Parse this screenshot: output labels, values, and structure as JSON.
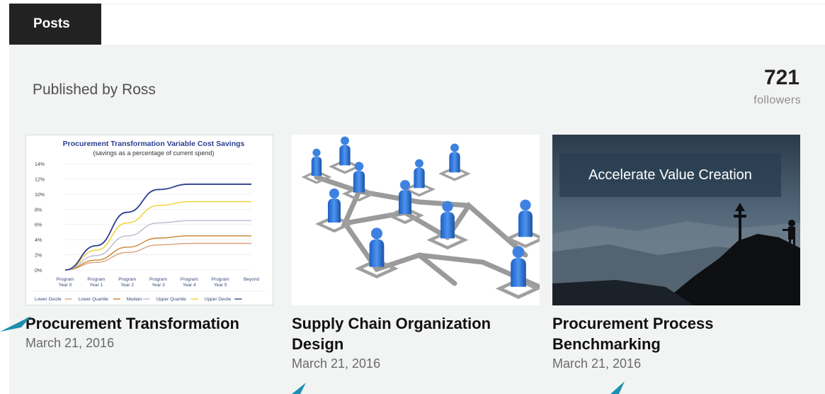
{
  "tab": {
    "label": "Posts"
  },
  "header": {
    "published_by": "Published by Ross",
    "followers_count": "721",
    "followers_label": "followers"
  },
  "posts": [
    {
      "title": "Procurement Transformation",
      "date": "March 21, 2016",
      "thumbnail": {
        "type": "chart",
        "chart_title": "Procurement Transformation Variable Cost Savings",
        "chart_subtitle": "(savings as a percentage of current spend)",
        "y_ticks": [
          "14%",
          "12%",
          "10%",
          "8%",
          "6%",
          "4%",
          "2%",
          "0%"
        ],
        "x_ticks": [
          [
            "Program",
            "Year 0"
          ],
          [
            "Program",
            "Year 1"
          ],
          [
            "Program",
            "Year 2"
          ],
          [
            "Program",
            "Year 3"
          ],
          [
            "Program",
            "Year 4"
          ],
          [
            "Program",
            "Year 5"
          ],
          [
            "Beyond",
            ""
          ]
        ],
        "legend": [
          "Lower Decile",
          "Lower Quartile",
          "Median",
          "Upper Quartile",
          "Upper Decile"
        ]
      }
    },
    {
      "title": "Supply Chain Organization Design",
      "date": "March 21, 2016",
      "thumbnail": {
        "type": "org-network"
      }
    },
    {
      "title": "Procurement Process Benchmarking",
      "date": "March 21, 2016",
      "thumbnail": {
        "type": "photo",
        "overlay_text": "Accelerate Value Creation"
      }
    }
  ],
  "chart_data": {
    "type": "line",
    "title": "Procurement Transformation Variable Cost Savings",
    "subtitle": "(savings as a percentage of current spend)",
    "categories": [
      "Program Year 0",
      "Program Year 1",
      "Program Year 2",
      "Program Year 3",
      "Program Year 4",
      "Program Year 5",
      "Beyond"
    ],
    "ylim": [
      0,
      14
    ],
    "series": [
      {
        "name": "Lower Decile",
        "color": "#d9a27a",
        "values": [
          0,
          1.0,
          2.3,
          3.3,
          3.5,
          3.5,
          3.5
        ]
      },
      {
        "name": "Lower Quartile",
        "color": "#c9852e",
        "values": [
          0,
          1.3,
          3.0,
          4.2,
          4.5,
          4.5,
          4.5
        ]
      },
      {
        "name": "Median",
        "color": "#b9bbd0",
        "values": [
          0,
          1.9,
          4.5,
          6.2,
          6.5,
          6.5,
          6.5
        ]
      },
      {
        "name": "Upper Quartile",
        "color": "#f0cf2a",
        "values": [
          0,
          2.6,
          6.2,
          8.5,
          9.0,
          9.0,
          9.0
        ]
      },
      {
        "name": "Upper Decile",
        "color": "#2b3f8c",
        "values": [
          0,
          3.2,
          7.6,
          10.6,
          11.3,
          11.3,
          11.3
        ]
      }
    ]
  },
  "colors": {
    "tab_bg": "#222222",
    "panel_bg": "#f2f3f3",
    "pointer": "#1f8fb0"
  }
}
